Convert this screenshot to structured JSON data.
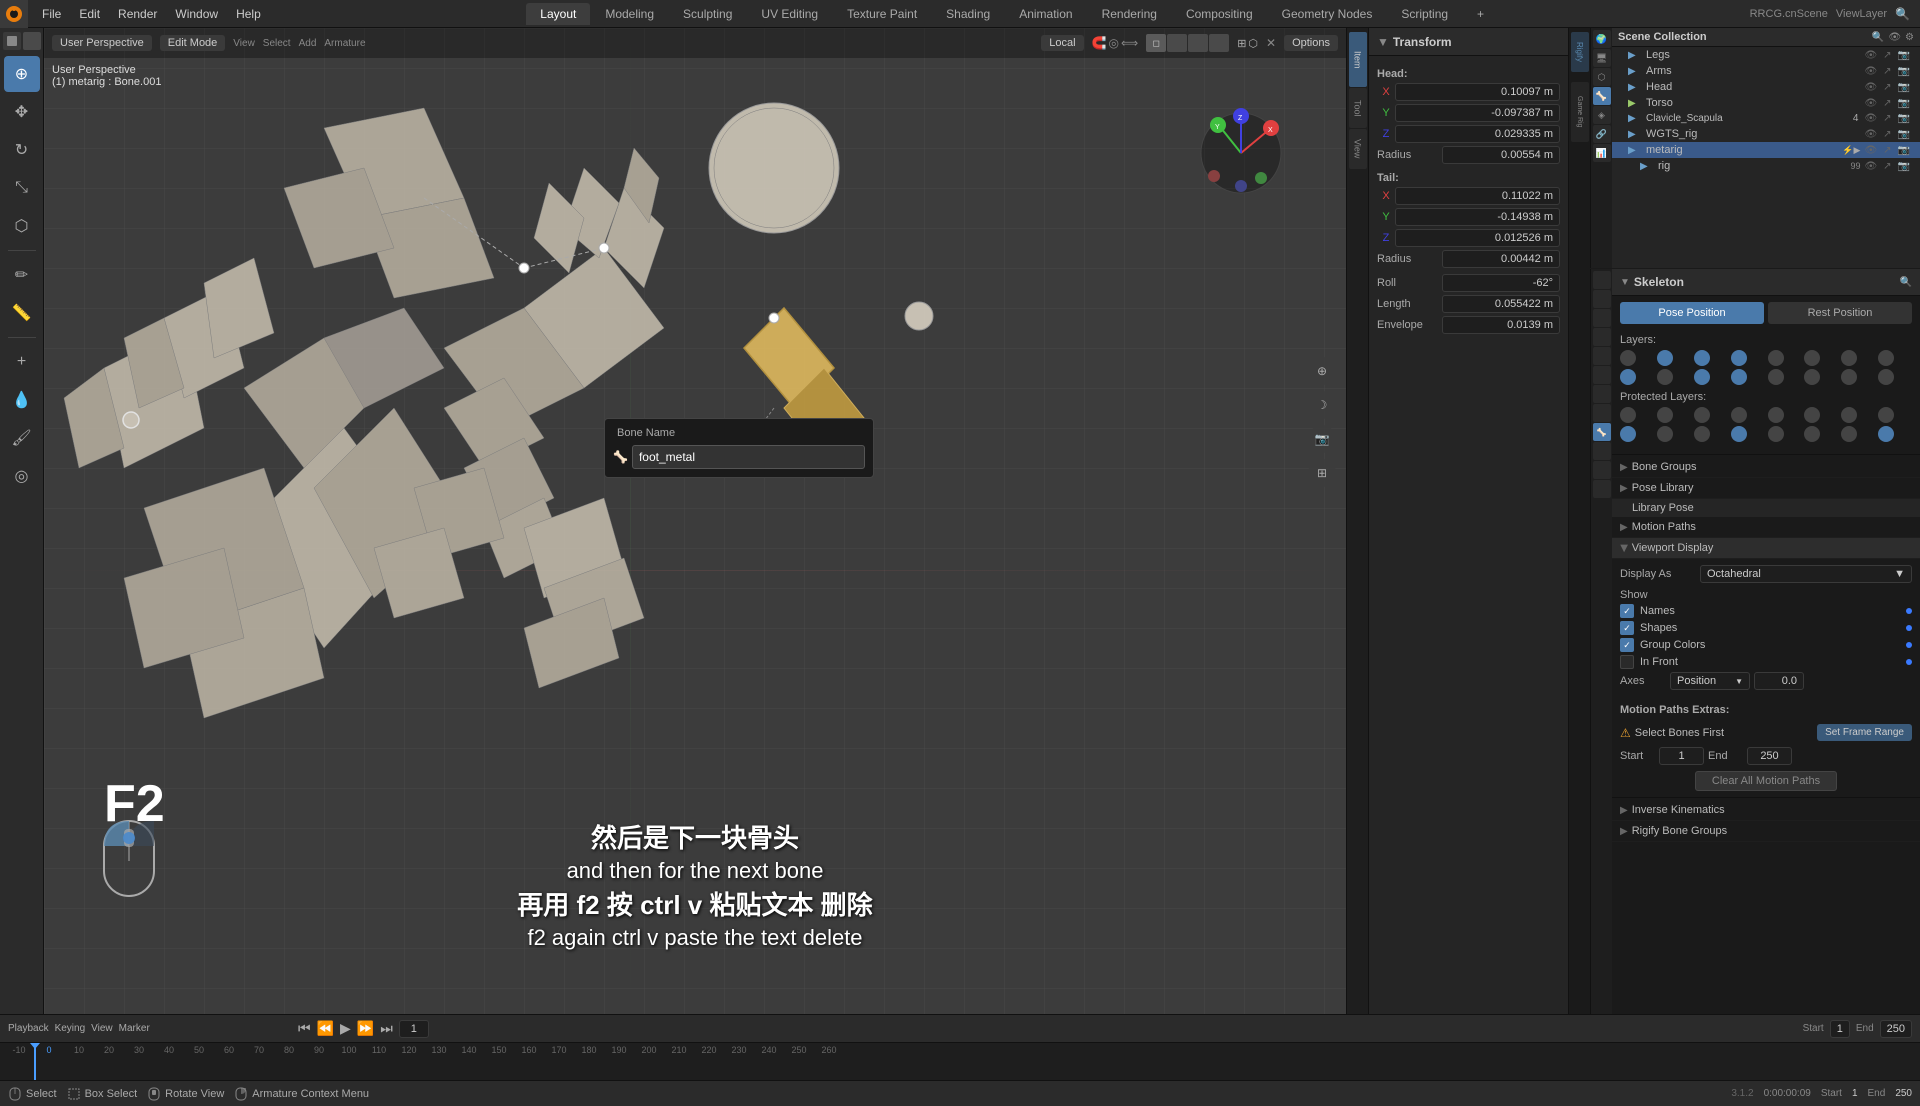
{
  "app": {
    "title": "RRCG.cn",
    "logo": "⬡",
    "version": "3.1.2"
  },
  "top_menu": {
    "items": [
      "Blender",
      "File",
      "Edit",
      "Render",
      "Window",
      "Help"
    ]
  },
  "workspace_tabs": [
    {
      "label": "Layout",
      "active": true
    },
    {
      "label": "Modeling"
    },
    {
      "label": "Sculpting"
    },
    {
      "label": "UV Editing"
    },
    {
      "label": "Texture Paint"
    },
    {
      "label": "Shading"
    },
    {
      "label": "Animation"
    },
    {
      "label": "Rendering"
    },
    {
      "label": "Compositing"
    },
    {
      "label": "Geometry Nodes"
    },
    {
      "label": "Scripting"
    },
    {
      "label": "+"
    }
  ],
  "viewport": {
    "perspective_label": "User Perspective",
    "mode_label": "Edit Mode",
    "bone_label": "(1) metarig : Bone.001",
    "local_label": "Local",
    "options_label": "Options"
  },
  "toolbar_left": {
    "tools": [
      "cursor",
      "move",
      "rotate",
      "scale",
      "transform",
      "annotate",
      "measure",
      "add",
      "select",
      "box-select",
      "lasso",
      "eyedropper"
    ]
  },
  "transform_panel": {
    "title": "Transform",
    "head_label": "Head:",
    "x_label": "X",
    "y_label": "Y",
    "z_label": "Z",
    "radius_label": "Radius",
    "head_x": "0.10097 m",
    "head_y": "-0.097387 m",
    "head_z": "0.029335 m",
    "head_radius": "0.00554 m",
    "tail_label": "Tail:",
    "tail_x": "0.11022 m",
    "tail_y": "-0.14938 m",
    "tail_z": "0.012526 m",
    "tail_radius": "0.00442 m",
    "roll_label": "Roll",
    "roll_value": "-62°",
    "length_label": "Length",
    "length_value": "0.055422 m",
    "envelope_label": "Envelope",
    "envelope_value": "0.0139 m"
  },
  "bone_popup": {
    "title": "Bone Name",
    "value": "foot_metal",
    "icon": "🦴"
  },
  "subtitles": {
    "cn1": "然后是下一块骨头",
    "en1": "and then for the next bone",
    "cn2": "再用 f2 按 ctrl v 粘贴文本 删除",
    "en2": "f2 again ctrl v paste the text delete"
  },
  "f2_label": "F2",
  "scene_collection": {
    "title": "Scene Collection",
    "items": [
      {
        "label": "Legs",
        "indent": 1,
        "icon": "arm",
        "active": false
      },
      {
        "label": "Arms",
        "indent": 1,
        "icon": "arm",
        "active": false
      },
      {
        "label": "Head",
        "indent": 1,
        "icon": "arm",
        "active": false
      },
      {
        "label": "Torso",
        "indent": 1,
        "icon": "mesh",
        "active": false
      },
      {
        "label": "Clavicle_Scapula",
        "indent": 1,
        "icon": "arm",
        "active": false
      },
      {
        "label": "WGTS_rig",
        "indent": 1,
        "icon": "arm",
        "active": false
      },
      {
        "label": "metarig",
        "indent": 1,
        "icon": "arm",
        "active": true
      },
      {
        "label": "rig",
        "indent": 2,
        "icon": "arm",
        "active": false
      }
    ]
  },
  "skeleton": {
    "title": "Skeleton",
    "pose_position_label": "Pose Position",
    "rest_position_label": "Rest Position",
    "layers_label": "Layers:",
    "protected_layers_label": "Protected Layers:",
    "active_layers": [
      1,
      2,
      3,
      8,
      10,
      11
    ],
    "bone_groups_label": "Bone Groups",
    "pose_library_label": "Pose Library",
    "library_pose_label": "Library Pose",
    "motion_paths_label": "Motion Paths"
  },
  "viewport_display": {
    "title": "Viewport Display",
    "display_as_label": "Display As",
    "display_as_value": "Octahedral",
    "show_label": "Show",
    "names_label": "Names",
    "shapes_label": "Shapes",
    "group_colors_label": "Group Colors",
    "in_front_label": "In Front",
    "axes_label": "Axes",
    "axes_value": "Position",
    "axes_num": "0.0"
  },
  "motion_paths": {
    "title": "Motion Paths Extras:",
    "select_bones_label": "Select Bones First",
    "set_frame_range_label": "Set Frame Range",
    "start_label": "Start",
    "start_value": "1",
    "end_label": "End",
    "end_value": "250",
    "clear_label": "Clear All Motion Paths"
  },
  "inverse_kinematics_label": "Inverse Kinematics",
  "rigify_bone_groups_label": "Rigify Bone Groups",
  "bottom_status": {
    "select_label": "Select",
    "box_select_label": "Box Select",
    "rotate_view_label": "Rotate View",
    "armature_context_label": "Armature Context Menu",
    "version": "3.1.2",
    "start_label": "Start",
    "start_value": "1",
    "end_label": "End",
    "end_value": "250",
    "time_display": "0:00:00:09"
  },
  "timeline": {
    "playback_label": "Playback",
    "keying_label": "Keying",
    "view_label": "View",
    "marker_label": "Marker",
    "marks": [
      "-10",
      "0",
      "10",
      "20",
      "30",
      "40",
      "50",
      "60",
      "70",
      "80",
      "90",
      "100",
      "110",
      "120",
      "130",
      "140",
      "150",
      "160",
      "170",
      "180",
      "190",
      "200",
      "210",
      "220",
      "230",
      "240",
      "250",
      "260"
    ]
  },
  "side_tabs": [
    {
      "label": "Item",
      "active": true
    },
    {
      "label": "Tool"
    },
    {
      "label": "View"
    }
  ],
  "props_tabs": [
    {
      "label": "🎬",
      "title": "Render"
    },
    {
      "label": "📤",
      "title": "Output"
    },
    {
      "label": "👁",
      "title": "View Layer"
    },
    {
      "label": "🌍",
      "title": "Scene"
    },
    {
      "label": "🖥",
      "title": "World"
    },
    {
      "label": "🤖",
      "title": "Object"
    },
    {
      "label": "✏️",
      "title": "Modifier"
    },
    {
      "label": "⬡",
      "title": "Particles"
    },
    {
      "label": "🦴",
      "title": "Armature",
      "active": true
    },
    {
      "label": "🔲",
      "title": "Bone"
    },
    {
      "label": "🎭",
      "title": "Bone Constraint"
    },
    {
      "label": "📊",
      "title": "Data"
    }
  ]
}
